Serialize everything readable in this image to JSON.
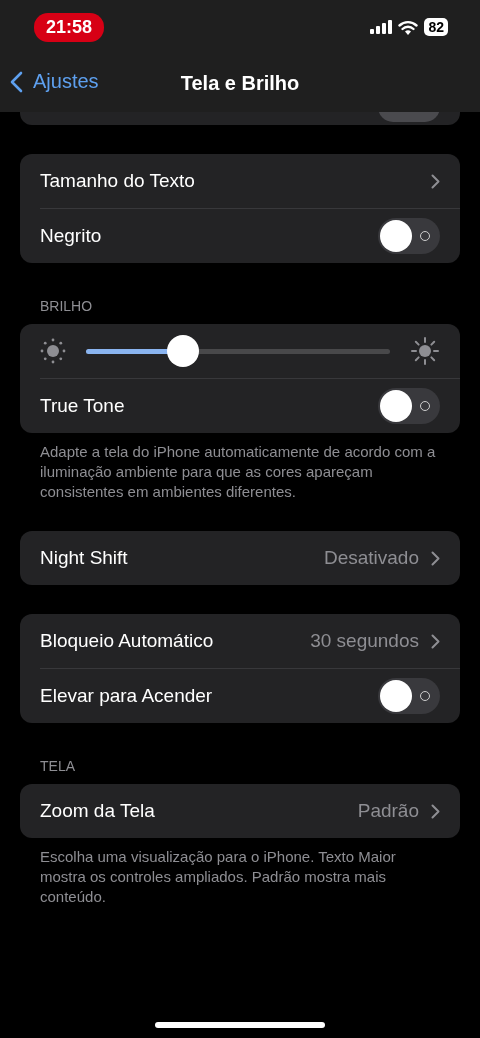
{
  "status_bar": {
    "time": "21:58",
    "battery": "82"
  },
  "nav": {
    "back": "Ajustes",
    "title": "Tela e Brilho"
  },
  "groups": [
    {
      "rows": [
        {
          "kind": "link",
          "label": "Tamanho do Texto"
        },
        {
          "kind": "toggle",
          "label": "Negrito",
          "on": false
        }
      ]
    },
    {
      "header": "BRILHO",
      "rows": [
        {
          "kind": "slider",
          "level": 0.32
        },
        {
          "kind": "toggle",
          "label": "True Tone",
          "on": false
        }
      ],
      "footer": "Adapte a tela do iPhone automaticamente de acordo com a iluminação ambiente para que as cores apareçam consistentes em ambientes diferentes."
    },
    {
      "rows": [
        {
          "kind": "link",
          "label": "Night Shift",
          "value": "Desativado"
        }
      ]
    },
    {
      "rows": [
        {
          "kind": "link",
          "label": "Bloqueio Automático",
          "value": "30 segundos"
        },
        {
          "kind": "toggle",
          "label": "Elevar para Acender",
          "on": false
        }
      ]
    },
    {
      "header": "TELA",
      "rows": [
        {
          "kind": "link",
          "label": "Zoom da Tela",
          "value": "Padrão"
        }
      ],
      "footer": "Escolha uma visualização para o iPhone. Texto Maior mostra os controles ampliados. Padrão mostra mais conteúdo."
    }
  ]
}
